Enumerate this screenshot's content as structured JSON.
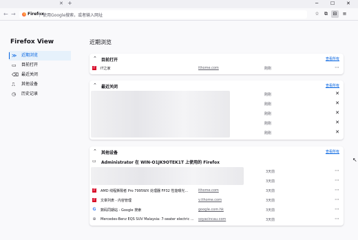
{
  "browser": {
    "tab_close": "✕",
    "new_tab": "+",
    "window_controls": [
      "─",
      "☐",
      "✕"
    ],
    "nav_icons": [
      "back-arrow-icon",
      "forward-arrow-icon"
    ],
    "identity": "Firefox",
    "url_placeholder": "使用Google搜索，或者输入网址",
    "toolbar_icons": [
      "star-icon",
      "extensions-icon",
      "pocket-icon",
      "menu-icon"
    ]
  },
  "sidebar": {
    "title": "Firefox View",
    "items": [
      {
        "label": "近期浏览",
        "icon": "≫",
        "icon_name": "history-arrows-icon",
        "active": true
      },
      {
        "label": "目前打开",
        "icon": "▭",
        "icon_name": "tabs-icon",
        "active": false
      },
      {
        "label": "最近关闭",
        "icon": "⌫",
        "icon_name": "closed-tab-icon",
        "active": false
      },
      {
        "label": "其他设备",
        "icon": "⎍",
        "icon_name": "devices-icon",
        "active": false
      },
      {
        "label": "历史记录",
        "icon": "◷",
        "icon_name": "clock-icon",
        "active": false
      }
    ]
  },
  "main": {
    "title": "近期浏览",
    "open_tabs": {
      "title": "目前打开",
      "view_all": "查看所有",
      "rows": [
        {
          "title": "IT之家",
          "url": "ithome.com",
          "time": "刚刚",
          "icon": "IT",
          "action": "⋯"
        }
      ]
    },
    "recently_closed": {
      "title": "最近关闭",
      "view_all": "查看所有",
      "rows": [
        {
          "title": "",
          "url": "",
          "time": "刚刚",
          "action": "✕"
        },
        {
          "title": "",
          "url": "",
          "time": "刚刚",
          "action": "✕"
        },
        {
          "title": "",
          "url": "",
          "time": "刚刚",
          "action": "✕"
        },
        {
          "title": "",
          "url": "",
          "time": "刚刚",
          "action": "✕"
        },
        {
          "title": "",
          "url": "",
          "time": "刚刚",
          "action": "✕"
        }
      ]
    },
    "other_devices": {
      "title": "其他设备",
      "view_all": "查看所有",
      "device": "Administrator 在 WIN-O1JK9OTEK1T 上使用的 Firefox",
      "rows": [
        {
          "title": "",
          "url": "",
          "time": "3天前",
          "action": "⋯"
        },
        {
          "title": "",
          "url": "",
          "time": "3天前",
          "action": "⋯"
        },
        {
          "title": "AMD 线程撕裂者 Pro 7995WX 处理器 FP32 性能曝光...",
          "url": "ithome.com",
          "time": "3天前",
          "icon": "IT",
          "action": "⋯"
        },
        {
          "title": "文章列表 - 内容管理",
          "url": "v.ithome.com",
          "time": "3天前",
          "icon": "IT",
          "action": "⋯"
        },
        {
          "title": "数码同期站 - Google 搜索",
          "url": "google.com.hk",
          "time": "3天前",
          "icon": "G",
          "action": "⋯"
        },
        {
          "title": "Mercedes-Benz EQS SUV Malaysia: 7-seater electric ...",
          "url": "soyacincau.com",
          "time": "3天前",
          "icon": "⊕",
          "action": "⋯"
        }
      ]
    }
  },
  "colors": {
    "accent": "#0061e0",
    "background": "#f9f9fb",
    "card": "#ffffff"
  }
}
